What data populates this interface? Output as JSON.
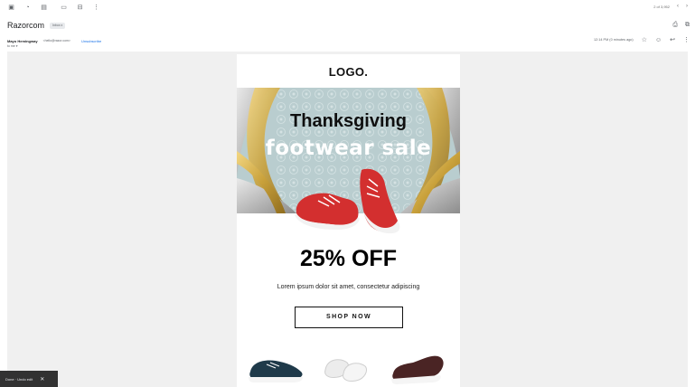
{
  "toolbar": {
    "icons": [
      "archive-icon",
      "report-spam-icon",
      "delete-icon",
      "mark-unread-icon",
      "move-to-icon",
      "more-icon"
    ],
    "pager_text": "2 of 3,952",
    "prev_icon": "chevron-left-icon",
    "next_icon": "chevron-right-icon"
  },
  "message": {
    "subject": "Razorcom",
    "chip": "Inbox x",
    "sender_name": "Mayo Hemingway",
    "sender_email": "<hello@razor.com>",
    "unsubscribe": "Unsubscribe",
    "to": "to me",
    "date": "12:14 PM (0 minutes ago)"
  },
  "email": {
    "logo": "LOGO.",
    "hero_title": "Thanksgiving",
    "hero_subtitle": "footwear sale",
    "discount": "25% OFF",
    "body": "Lorem ipsum dolor sit amet, consectetur adipiscing",
    "cta": "SHOP NOW"
  },
  "snackbar": {
    "text": "Done · Undo edit"
  },
  "colors": {
    "hero_bg": "#b9cdcf",
    "canvas_bg": "#f0f0f0",
    "shoe_red": "#d32f2f",
    "gold": "#c9a13b"
  }
}
